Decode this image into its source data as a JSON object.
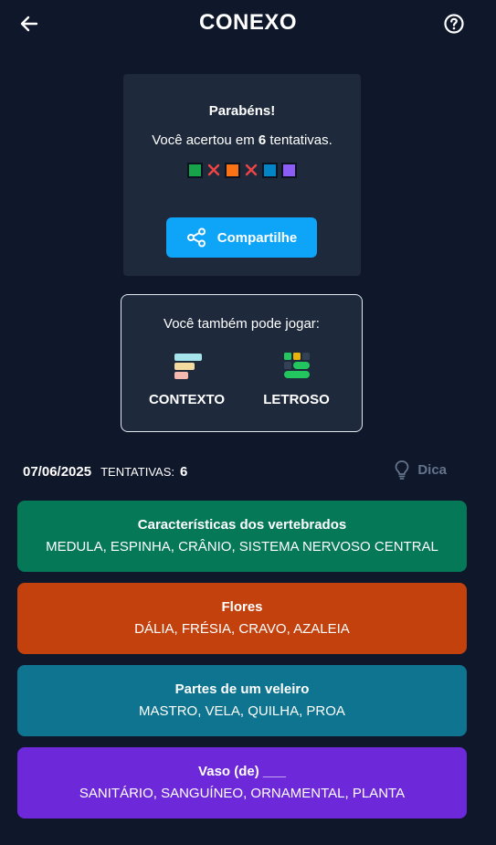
{
  "header": {
    "title": "CONEXO"
  },
  "result": {
    "congrats": "Parabéns!",
    "attempts_prefix": "Você acertou em ",
    "attempts_count": "6",
    "attempts_suffix": " tentativas.",
    "history": [
      {
        "type": "square",
        "color": "#16a34a"
      },
      {
        "type": "x",
        "color": "#ef4444"
      },
      {
        "type": "square",
        "color": "#f97316"
      },
      {
        "type": "x",
        "color": "#ef4444"
      },
      {
        "type": "square",
        "color": "#0284c7"
      },
      {
        "type": "square",
        "color": "#8b5cf6"
      }
    ],
    "share_label": "Compartilhe"
  },
  "more_games": {
    "title": "Você também pode jogar:",
    "games": [
      {
        "label": "CONTEXTO",
        "icon": "contexto-icon"
      },
      {
        "label": "LETROSO",
        "icon": "letroso-icon"
      }
    ]
  },
  "info": {
    "date": "07/06/2025",
    "attempts_label": "TENTATIVAS:",
    "attempts_value": "6",
    "hint_label": "Dica"
  },
  "groups": [
    {
      "title": "Características dos vertebrados",
      "words": "MEDULA, ESPINHA, CRÂNIO, SISTEMA NERVOSO CENTRAL",
      "color": "#047857"
    },
    {
      "title": "Flores",
      "words": "DÁLIA, FRÉSIA, CRAVO, AZALEIA",
      "color": "#c2410c"
    },
    {
      "title": "Partes de um veleiro",
      "words": "MASTRO, VELA, QUILHA, PROA",
      "color": "#0e7490"
    },
    {
      "title": "Vaso (de) ___",
      "words": "SANITÁRIO, SANGUÍNEO, ORNAMENTAL, PLANTA",
      "color": "#6d28d9"
    }
  ]
}
